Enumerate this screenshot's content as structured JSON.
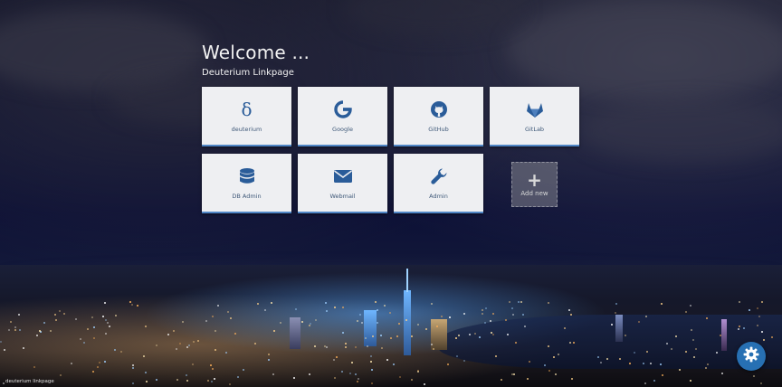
{
  "header": {
    "title": "Welcome ...",
    "subtitle": "Deuterium Linkpage"
  },
  "tiles": [
    {
      "label": "deuterium",
      "icon": "delta-icon"
    },
    {
      "label": "Google",
      "icon": "google-icon"
    },
    {
      "label": "GitHub",
      "icon": "github-icon"
    },
    {
      "label": "GitLab",
      "icon": "gitlab-icon"
    },
    {
      "label": "DB Admin",
      "icon": "database-icon"
    },
    {
      "label": "Webmail",
      "icon": "envelope-icon"
    },
    {
      "label": "Admin",
      "icon": "wrench-icon"
    }
  ],
  "add_tile": {
    "label": "Add new",
    "icon": "plus-icon"
  },
  "footer": {
    "text": "deuterium linkpage"
  },
  "settings": {
    "icon": "gear-icon"
  },
  "colors": {
    "accent": "#2770b3",
    "tile_bg": "#eeeff2",
    "icon": "#2a5c99"
  }
}
